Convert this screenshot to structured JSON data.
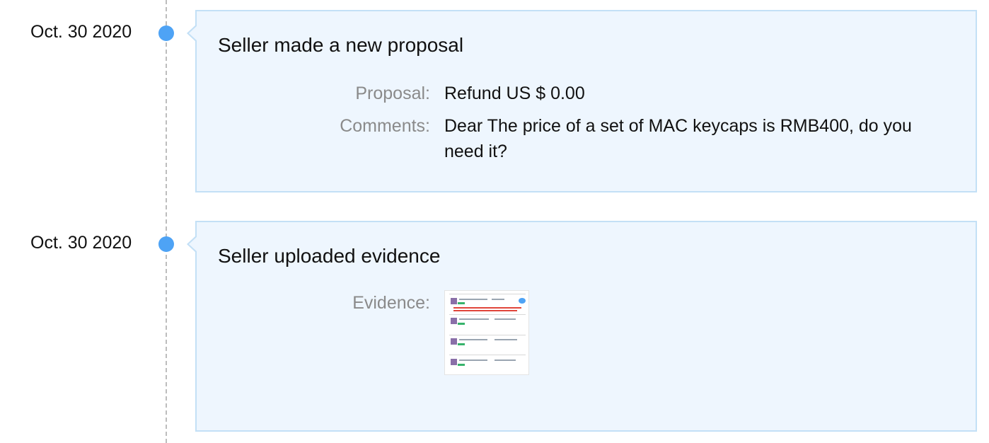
{
  "events": [
    {
      "date": "Oct. 30 2020",
      "title": "Seller made a new proposal",
      "fields": [
        {
          "label": "Proposal:",
          "value": "Refund US $ 0.00"
        },
        {
          "label": "Comments:",
          "value": "Dear The price of a set of MAC keycaps is RMB400, do you need it?"
        }
      ]
    },
    {
      "date": "Oct. 30 2020",
      "title": "Seller uploaded evidence",
      "fields": [
        {
          "label": "Evidence:"
        }
      ]
    }
  ],
  "colors": {
    "timeline_dot": "#4ea3f5",
    "card_background": "#eef6fe",
    "card_border": "#c3e0f6",
    "label_text": "#8a8a8a"
  },
  "icons": {
    "evidence": "evidence-thumbnail"
  }
}
